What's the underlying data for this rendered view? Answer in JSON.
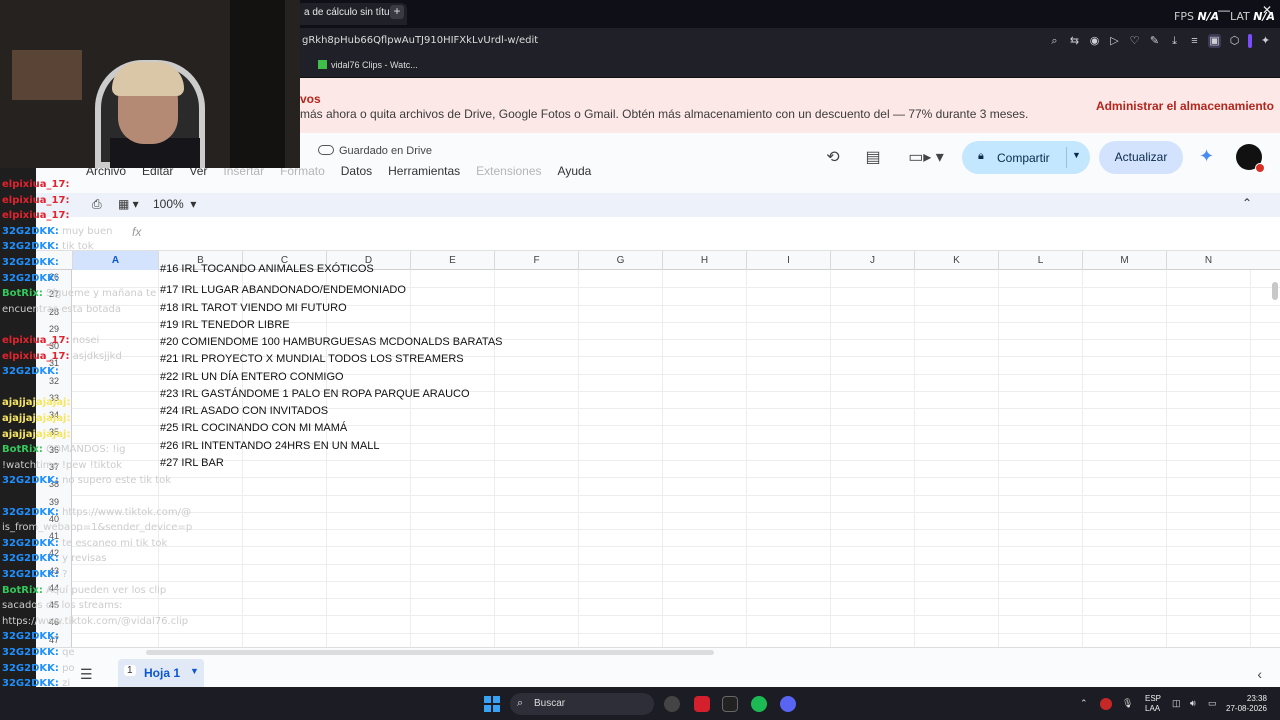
{
  "browser": {
    "tab_title": "a de cálculo sin título",
    "new_tab": "+",
    "fps_label": "FPS",
    "fps_value": "N/A",
    "lat_label": "LAT",
    "lat_value": "N/A",
    "minimize": "—",
    "close": "✕",
    "url": "gRkh8pHub66QflpwAuTJ910HIFXkLvUrdl-w/edit",
    "bookmark": "vidal76 Clips - Watc..."
  },
  "banner": {
    "title": "vos",
    "message": "más ahora o quita archivos de Drive, Google Fotos o Gmail. Obtén más almacenamiento con un descuento del — 77% durante 3 meses.",
    "action": "Administrar el almacenamiento"
  },
  "docs": {
    "saved": "Guardado en Drive",
    "menus": [
      "Archivo",
      "Editar",
      "Ver",
      "Insertar",
      "Formato",
      "Datos",
      "Herramientas",
      "Extensiones",
      "Ayuda"
    ],
    "share": "Compartir",
    "update": "Actualizar",
    "zoom": "100%",
    "fx": "fx"
  },
  "sheet": {
    "columns": [
      "A",
      "B",
      "C",
      "D",
      "E",
      "F",
      "G",
      "H",
      "I",
      "J",
      "K",
      "L",
      "M",
      "N"
    ],
    "rows": [
      "26",
      "27",
      "28",
      "29",
      "30",
      "31",
      "32",
      "33",
      "34",
      "35",
      "36",
      "37",
      "38",
      "39",
      "40",
      "41",
      "42",
      "43",
      "44",
      "45",
      "46",
      "47"
    ],
    "cells": [
      "#16 IRL TOCANDO ANIMALES EXÓTICOS",
      "#17 IRL LUGAR ABANDONADO/ENDEMONIADO",
      "#18 IRL TAROT VIENDO MI FUTURO",
      "#19 IRL TENEDOR LIBRE",
      "#20 COMIENDOME 100 HAMBURGUESAS MCDONALDS BARATAS",
      "#21 IRL PROYECTO X MUNDIAL TODOS LOS STREAMERS",
      "#22 IRL UN DÍA ENTERO CONMIGO",
      "#23 IRL GASTÁNDOME 1 PALO EN ROPA PARQUE ARAUCO",
      "#24 IRL ASADO CON INVITADOS",
      "#25 IRL COCINANDO CON MI MAMÁ",
      "#26 IRL INTENTANDO 24HRS EN UN MALL",
      "#27 IRL BAR"
    ],
    "tab_number": "1",
    "tab_name": "Hoja 1"
  },
  "taskbar": {
    "search": "Buscar",
    "lang_1": "ESP",
    "lang_2": "LAA",
    "time": "23:38",
    "date": "27-08-2026"
  },
  "chat": {
    "messages": [
      {
        "user": "elpixiua_17:",
        "text": "",
        "color": "#e0232e"
      },
      {
        "user": "elpixiua_17:",
        "text": "",
        "color": "#e0232e"
      },
      {
        "user": "elpixiua_17:",
        "text": "",
        "color": "#e0232e"
      },
      {
        "user": "32G2DKK:",
        "text": "muy buen",
        "color": "#1e90ff"
      },
      {
        "user": "32G2DKK:",
        "text": "tik tok",
        "color": "#1e90ff"
      },
      {
        "user": "32G2DKK:",
        "text": "",
        "color": "#1e90ff"
      },
      {
        "user": "32G2DKK:",
        "text": "",
        "color": "#1e90ff"
      },
      {
        "user": "BotRix:",
        "text": "Sígueme y mañana te",
        "color": "#34c759"
      },
      {
        "user": "",
        "text": "encuentras esta botada",
        "color": "#ffffff"
      },
      {
        "user": "",
        "text": "",
        "color": "#ffffff"
      },
      {
        "user": "elpixiua_17:",
        "text": "nosei",
        "color": "#e0232e"
      },
      {
        "user": "elpixiua_17:",
        "text": "asjdksjjkd",
        "color": "#e0232e"
      },
      {
        "user": "32G2DKK:",
        "text": "",
        "color": "#1e90ff"
      },
      {
        "user": "",
        "text": "",
        "color": "#ffffff"
      },
      {
        "user": "ajajjajajajaj:",
        "text": "",
        "color": "#f5e663"
      },
      {
        "user": "ajajjajajajaj:",
        "text": "",
        "color": "#f5e663"
      },
      {
        "user": "ajajjajajajaj:",
        "text": "",
        "color": "#f5e663"
      },
      {
        "user": "BotRix:",
        "text": "COMANDOS: !ig",
        "color": "#34c759"
      },
      {
        "user": "",
        "text": "!watchtime !pew !tiktok",
        "color": "#ffffff"
      },
      {
        "user": "32G2DKK:",
        "text": "no supero este tik tok",
        "color": "#1e90ff"
      },
      {
        "user": "",
        "text": "",
        "color": "#ffffff"
      },
      {
        "user": "32G2DKK:",
        "text": "https://www.tiktok.com/@",
        "color": "#1e90ff"
      },
      {
        "user": "",
        "text": "is_from_webapp=1&sender_device=p",
        "color": "#ffffff"
      },
      {
        "user": "32G2DKK:",
        "text": "te escaneo mi tik tok",
        "color": "#1e90ff"
      },
      {
        "user": "32G2DKK:",
        "text": "y revisas",
        "color": "#1e90ff"
      },
      {
        "user": "32G2DKK:",
        "text": "?",
        "color": "#1e90ff"
      },
      {
        "user": "BotRix:",
        "text": "Aquí pueden ver los clip",
        "color": "#34c759"
      },
      {
        "user": "",
        "text": "sacados de los streams:",
        "color": "#ffffff"
      },
      {
        "user": "",
        "text": "https://www.tiktok.com/@vidal76.clip",
        "color": "#ffffff"
      },
      {
        "user": "32G2DKK:",
        "text": "",
        "color": "#1e90ff"
      },
      {
        "user": "32G2DKK:",
        "text": "qe",
        "color": "#1e90ff"
      },
      {
        "user": "32G2DKK:",
        "text": "po",
        "color": "#1e90ff"
      },
      {
        "user": "32G2DKK:",
        "text": "zi",
        "color": "#1e90ff"
      }
    ]
  },
  "colors": {
    "accent": "#0b57d0",
    "banner_bg": "#fce8e6",
    "share_bg": "#c2e7ff",
    "selected_col": "#d3e3fd"
  },
  "icons": [
    "history-icon",
    "comment-icon",
    "video-call-icon",
    "lock-icon",
    "gemini-icon",
    "print-icon",
    "paint-format-icon",
    "cloud-icon",
    "windows-start-icon",
    "search-icon"
  ]
}
